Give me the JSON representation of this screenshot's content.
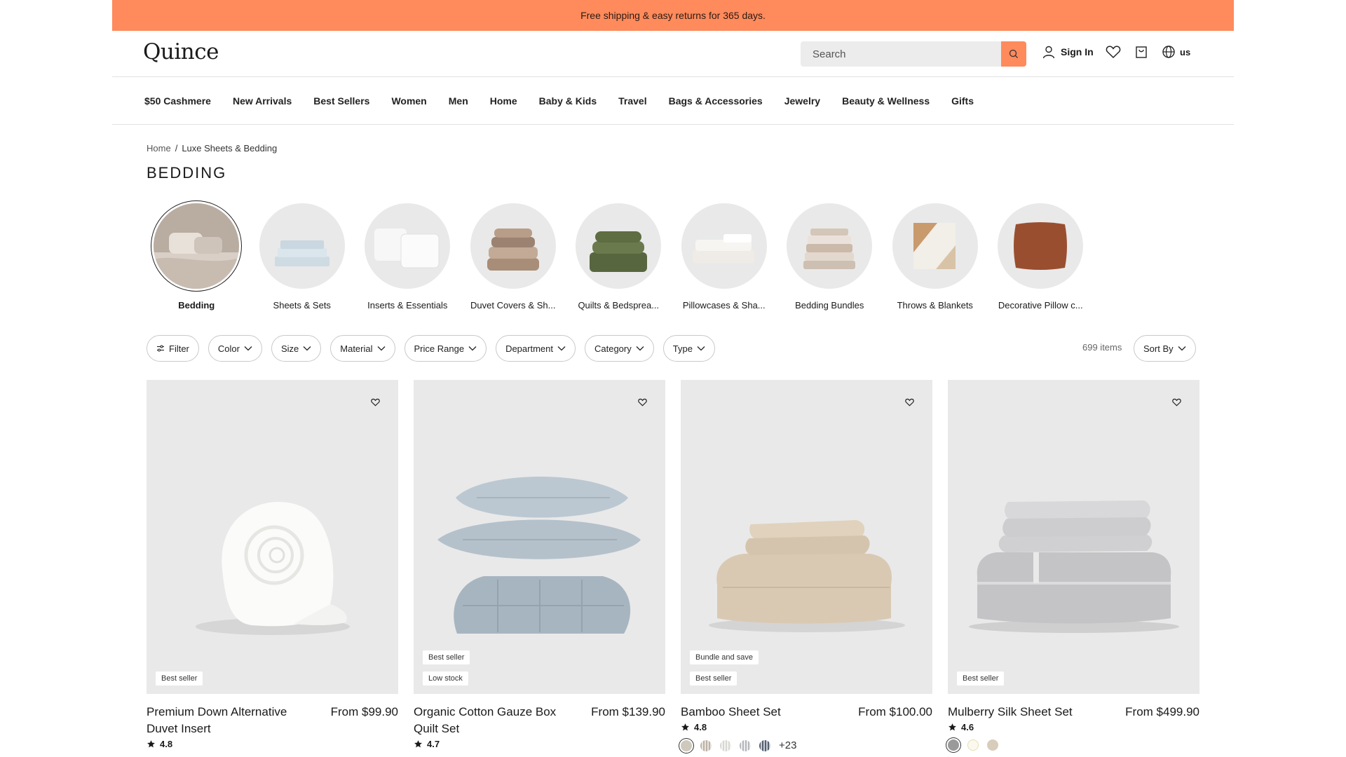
{
  "promo": {
    "text": "Free shipping & easy returns for 365 days."
  },
  "header": {
    "logo": "Quince",
    "search_placeholder": "Search",
    "sign_in": "Sign In",
    "locale": "us"
  },
  "nav": [
    "$50 Cashmere",
    "New Arrivals",
    "Best Sellers",
    "Women",
    "Men",
    "Home",
    "Baby & Kids",
    "Travel",
    "Bags & Accessories",
    "Jewelry",
    "Beauty & Wellness",
    "Gifts"
  ],
  "breadcrumb": {
    "home": "Home",
    "separator": "/",
    "current": "Luxe Sheets & Bedding"
  },
  "page_title": "BEDDING",
  "categories": [
    {
      "label": "Bedding",
      "active": true
    },
    {
      "label": "Sheets & Sets"
    },
    {
      "label": "Inserts & Essentials"
    },
    {
      "label": "Duvet Covers & Sh..."
    },
    {
      "label": "Quilts & Bedsprea..."
    },
    {
      "label": "Pillowcases & Sha..."
    },
    {
      "label": "Bedding Bundles"
    },
    {
      "label": "Throws & Blankets"
    },
    {
      "label": "Decorative Pillow c..."
    }
  ],
  "filters": [
    "Filter",
    "Color",
    "Size",
    "Material",
    "Price Range",
    "Department",
    "Category",
    "Type"
  ],
  "item_count": "699 items",
  "sort_label": "Sort By",
  "products": [
    {
      "name": "Premium Down Alternative Duvet Insert",
      "price": "From $99.90",
      "rating": "4.8",
      "badges": [
        "Best seller"
      ]
    },
    {
      "name": "Organic Cotton Gauze Box Quilt Set",
      "price": "From $139.90",
      "rating": "4.7",
      "badges": [
        "Best seller",
        "Low stock"
      ]
    },
    {
      "name": "Bamboo Sheet Set",
      "price": "From $100.00",
      "rating": "4.8",
      "badges": [
        "Bundle and save",
        "Best seller"
      ],
      "more_colors": "+23"
    },
    {
      "name": "Mulberry Silk Sheet Set",
      "price": "From $499.90",
      "rating": "4.6",
      "badges": [
        "Best seller"
      ]
    }
  ],
  "colors": {
    "promo": "#ff8a5c",
    "search_button": "#ff8a5c",
    "card_bg": "#e9e9e9"
  },
  "icons": [
    "search-icon",
    "user-icon",
    "heart-icon",
    "bag-icon",
    "globe-icon",
    "filter-icon",
    "chevron-down-icon",
    "star-icon"
  ]
}
